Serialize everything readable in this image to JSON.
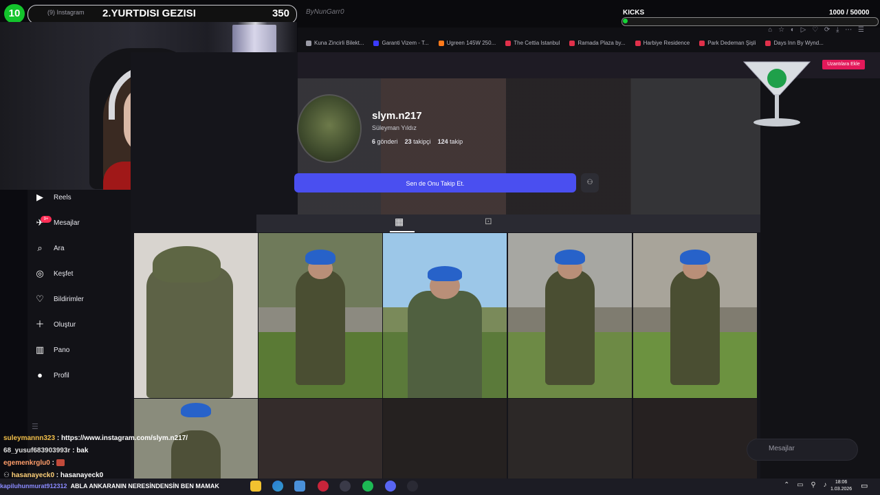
{
  "overlay": {
    "level": "10",
    "goal_small": "(9) Instagram",
    "goal_title": "2.YURTDISI GEZISI",
    "goal_count": "350",
    "channel": "ByNunGarr0",
    "kicks_label": "KICKS",
    "kicks_count": "1000  / 50000",
    "kicks_progress": 0.02
  },
  "bookmarks": [
    {
      "label": "Kuna Zincirli Bilekt...",
      "color": "#9a9aa5"
    },
    {
      "label": "Garanti Vizem - T...",
      "color": "#3b3bff"
    },
    {
      "label": "Ugreen 145W 250...",
      "color": "#ff7a1a"
    },
    {
      "label": "The Cettia Istanbul",
      "color": "#e0304a"
    },
    {
      "label": "Ramada Plaza by...",
      "color": "#e0304a"
    },
    {
      "label": "Harbiye Residence",
      "color": "#e0304a"
    },
    {
      "label": "Park Dedeman Şişli",
      "color": "#e0304a"
    },
    {
      "label": "Days Inn By Wynd...",
      "color": "#e0304a"
    }
  ],
  "profile": {
    "username": "slym.n217",
    "fullname": "Süleyman Yıldız",
    "posts": "6",
    "posts_label": "gönderi",
    "followers": "23",
    "followers_label": "takipçi",
    "following": "124",
    "following_label": "takip",
    "follow_button": "Sen de Onu Takip Et."
  },
  "sidebar": {
    "items": [
      {
        "label": "Reels",
        "icon": "reels-icon"
      },
      {
        "label": "Mesajlar",
        "icon": "messages-icon",
        "badge": "9+"
      },
      {
        "label": "Ara",
        "icon": "search-icon"
      },
      {
        "label": "Keşfet",
        "icon": "explore-icon"
      },
      {
        "label": "Bildirimler",
        "icon": "heart-icon"
      },
      {
        "label": "Oluştur",
        "icon": "plus-icon"
      },
      {
        "label": "Pano",
        "icon": "dashboard-icon"
      },
      {
        "label": "Profil",
        "icon": "profile-icon"
      }
    ]
  },
  "promo": {
    "button": "Uzantılara Ekle"
  },
  "chat": [
    {
      "user": "suleymannn323",
      "msg": "https://www.instagram.com/slym.n217/"
    },
    {
      "user": "68_yusuf683903993r",
      "msg": "bak"
    },
    {
      "user": "egemenkrglu0",
      "msg": ""
    },
    {
      "user": "hasanayeck0",
      "msg": "hasanayeck0"
    }
  ],
  "dm": {
    "label": "Mesajlar"
  },
  "ticker": {
    "prefix": "kapiluhunmurat912312",
    "text": "ABLA ANKARANIN NERESİNDENSİN BEN MAMAK"
  },
  "clock": {
    "time": "18:06",
    "date": "1.03.2026"
  }
}
